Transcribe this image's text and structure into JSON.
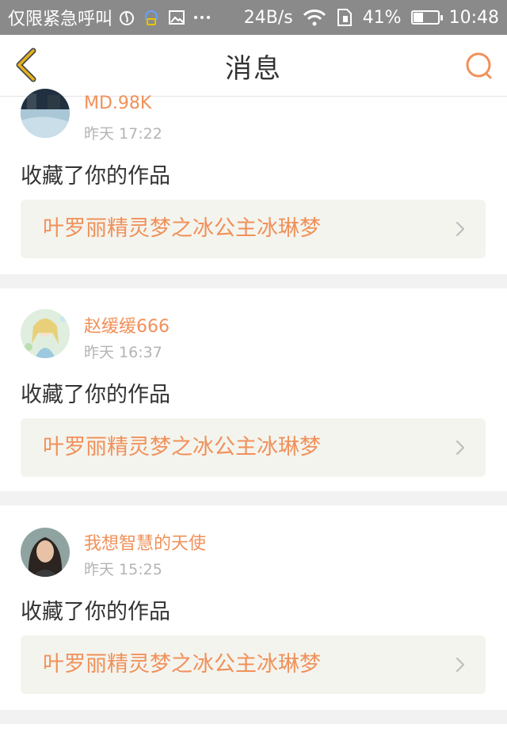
{
  "status_bar": {
    "carrier": "仅限紧急呼叫",
    "speed": "24B/s",
    "battery": "41%",
    "time": "10:48",
    "icons": [
      "fire-icon",
      "headset-icon",
      "image-icon",
      "more-icon",
      "wifi-icon",
      "sim-icon",
      "battery-icon"
    ]
  },
  "nav": {
    "title": "消息",
    "back_icon": "chevron-left-icon",
    "search_icon": "search-icon"
  },
  "colors": {
    "accent": "#f0915a",
    "back": "#e6b21e",
    "card_bg": "#ffffff",
    "page_bg": "#f2f2f2",
    "work_bg": "#f4f4ee"
  },
  "messages": [
    {
      "user": "MD.98K",
      "time": "昨天 17:22",
      "action": "收藏了你的作品",
      "work": "叶罗丽精灵梦之冰公主冰琳梦"
    },
    {
      "user": "赵缓缓666",
      "time": "昨天 16:37",
      "action": "收藏了你的作品",
      "work": "叶罗丽精灵梦之冰公主冰琳梦"
    },
    {
      "user": "我想智慧的天使",
      "time": "昨天 15:25",
      "action": "收藏了你的作品",
      "work": "叶罗丽精灵梦之冰公主冰琳梦"
    }
  ]
}
